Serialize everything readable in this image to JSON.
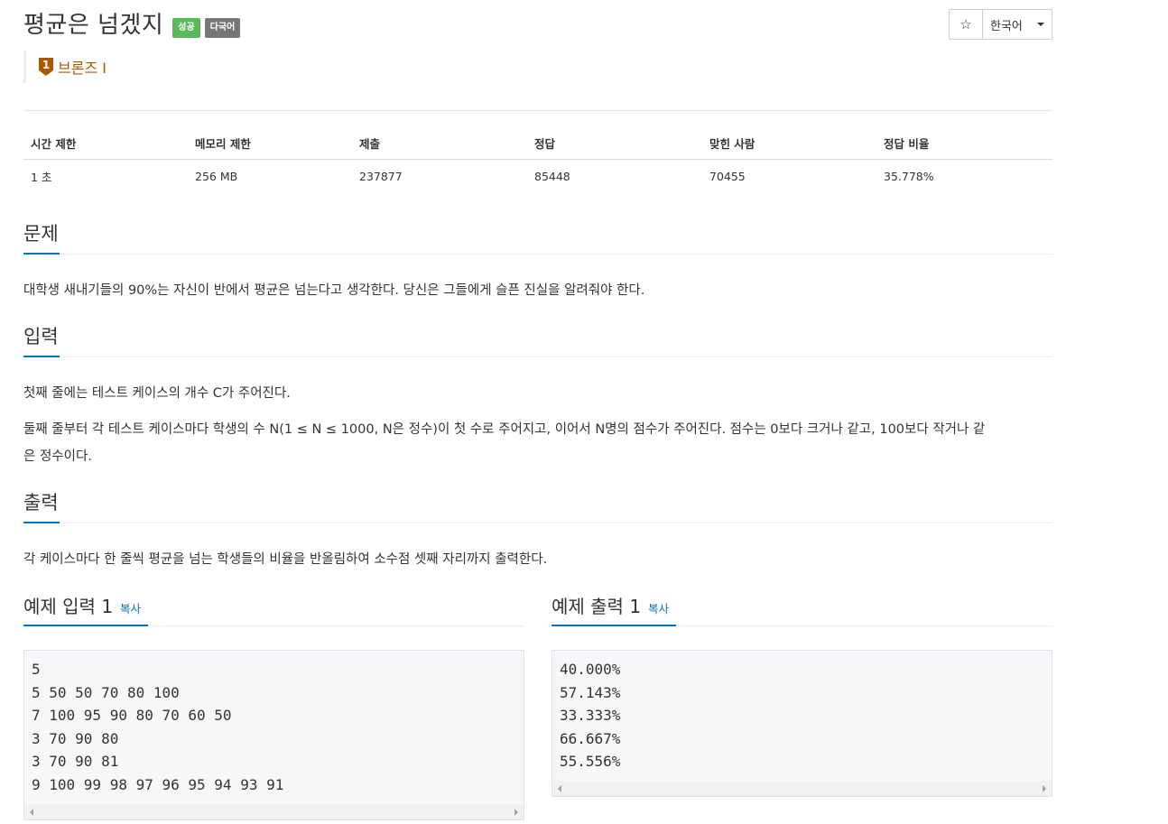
{
  "problem": {
    "title": "평균은 넘겠지",
    "badges": {
      "success": "성공",
      "multilang": "다국어"
    },
    "tier": {
      "number": "1",
      "label": "브론즈 I"
    }
  },
  "toolbar": {
    "star_icon": "☆",
    "language": "한국어"
  },
  "stats": {
    "headers": [
      "시간 제한",
      "메모리 제한",
      "제출",
      "정답",
      "맞힌 사람",
      "정답 비율"
    ],
    "values": [
      "1 초",
      "256 MB",
      "237877",
      "85448",
      "70455",
      "35.778%"
    ]
  },
  "sections": {
    "problem": {
      "title": "문제",
      "body": "대학생 새내기들의 90%는 자신이 반에서 평균은 넘는다고 생각한다. 당신은 그들에게 슬픈 진실을 알려줘야 한다."
    },
    "input": {
      "title": "입력",
      "body1": "첫째 줄에는 테스트 케이스의 개수 C가 주어진다.",
      "body2_line1": "둘째 줄부터 각 테스트 케이스마다 학생의 수 N(1 ≤ N ≤ 1000, N은 정수)이 첫 수로 주어지고, 이어서 N명의 점수가 주어진다. 점수는 0보다 크거나 같고, 100보다 작거나 같",
      "body2_line2": "은 정수이다."
    },
    "output": {
      "title": "출력",
      "body": "각 케이스마다 한 줄씩 평균을 넘는 학생들의 비율을 반올림하여 소수점 셋째 자리까지 출력한다."
    }
  },
  "samples": {
    "input": {
      "title": "예제 입력 1",
      "copy": "복사",
      "lines": [
        "5",
        "5 50 50 70 80 100",
        "7 100 95 90 80 70 60 50",
        "3 70 90 80",
        "3 70 90 81",
        "9 100 99 98 97 96 95 94 93 91"
      ]
    },
    "output": {
      "title": "예제 출력 1",
      "copy": "복사",
      "lines": [
        "40.000%",
        "57.143%",
        "33.333%",
        "66.667%",
        "55.556%"
      ]
    }
  },
  "colors": {
    "accent": "#0076c0",
    "success": "#5cb85c",
    "bronze": "#ad5600",
    "lang_badge": "#777777"
  }
}
